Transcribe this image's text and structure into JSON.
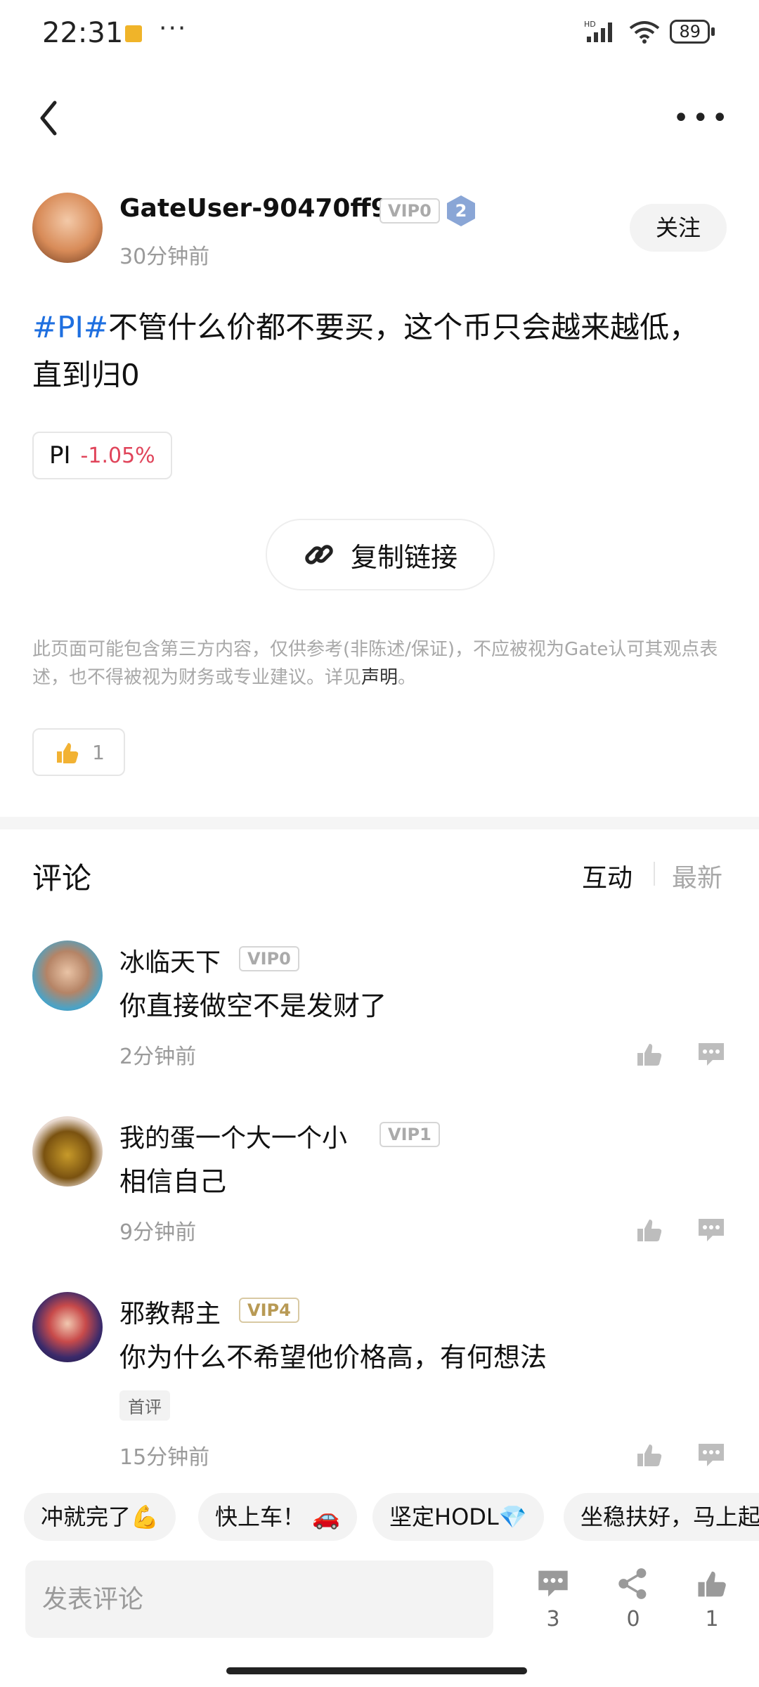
{
  "status_bar": {
    "time": "22:31",
    "dots": "···",
    "network": "HD",
    "battery": "89"
  },
  "post": {
    "author": {
      "name": "GateUser-90470ff9",
      "vip": "VIP0",
      "level": "2",
      "time": "30分钟前"
    },
    "follow_label": "关注",
    "hashtag": "#PI#",
    "content": "不管什么价都不要买，这个币只会越来越低，直到归0",
    "coin": {
      "name": "PI",
      "change": "-1.05%"
    },
    "copy_link_label": "复制链接",
    "disclaimer": "此页面可能包含第三方内容，仅供参考(非陈述/保证)，不应被视为Gate认可其观点表述，也不得被视为财务或专业建议。详见",
    "disclaimer_link": "声明",
    "disclaimer_end": "。",
    "likes": "1"
  },
  "comments_header": {
    "title": "评论",
    "sort_hot": "互动",
    "sort_new": "最新"
  },
  "comments": [
    {
      "name": "冰临天下",
      "vip": "VIP0",
      "text": "你直接做空不是发财了",
      "time": "2分钟前"
    },
    {
      "name": "我的蛋一个大一个小",
      "vip": "VIP1",
      "text": "相信自己",
      "time": "9分钟前"
    },
    {
      "name": "邪教帮主",
      "vip": "VIP4",
      "text": "你为什么不希望他价格高，有何想法",
      "tag": "首评",
      "time": "15分钟前"
    }
  ],
  "quick_replies": [
    "冲就完了💪",
    "快上车！ 🚗",
    "坚定HODL💎",
    "坐稳扶好，马上起"
  ],
  "bottom_bar": {
    "input_placeholder": "发表评论",
    "comments_count": "3",
    "share_count": "0",
    "like_count": "1"
  },
  "colors": {
    "hashtag": "#1e6fe0",
    "negative": "#e0445a",
    "muted": "#9a9a9a"
  },
  "icons": [
    "back-icon",
    "more-icon",
    "link-icon",
    "thumbs-up-icon",
    "comment-icon",
    "share-icon",
    "wifi-icon",
    "signal-icon"
  ]
}
